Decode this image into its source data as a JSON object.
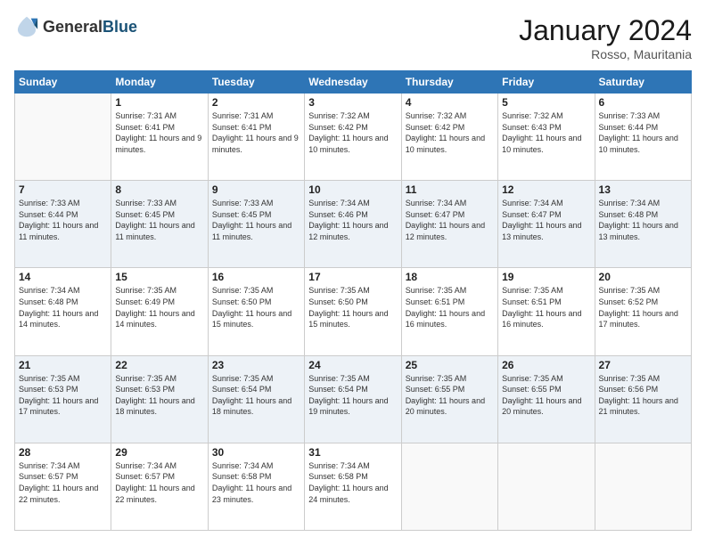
{
  "header": {
    "logo_general": "General",
    "logo_blue": "Blue",
    "month_title": "January 2024",
    "location": "Rosso, Mauritania"
  },
  "weekdays": [
    "Sunday",
    "Monday",
    "Tuesday",
    "Wednesday",
    "Thursday",
    "Friday",
    "Saturday"
  ],
  "weeks": [
    [
      {
        "day": "",
        "sunrise": "",
        "sunset": "",
        "daylight": ""
      },
      {
        "day": "1",
        "sunrise": "Sunrise: 7:31 AM",
        "sunset": "Sunset: 6:41 PM",
        "daylight": "Daylight: 11 hours and 9 minutes."
      },
      {
        "day": "2",
        "sunrise": "Sunrise: 7:31 AM",
        "sunset": "Sunset: 6:41 PM",
        "daylight": "Daylight: 11 hours and 9 minutes."
      },
      {
        "day": "3",
        "sunrise": "Sunrise: 7:32 AM",
        "sunset": "Sunset: 6:42 PM",
        "daylight": "Daylight: 11 hours and 10 minutes."
      },
      {
        "day": "4",
        "sunrise": "Sunrise: 7:32 AM",
        "sunset": "Sunset: 6:42 PM",
        "daylight": "Daylight: 11 hours and 10 minutes."
      },
      {
        "day": "5",
        "sunrise": "Sunrise: 7:32 AM",
        "sunset": "Sunset: 6:43 PM",
        "daylight": "Daylight: 11 hours and 10 minutes."
      },
      {
        "day": "6",
        "sunrise": "Sunrise: 7:33 AM",
        "sunset": "Sunset: 6:44 PM",
        "daylight": "Daylight: 11 hours and 10 minutes."
      }
    ],
    [
      {
        "day": "7",
        "sunrise": "Sunrise: 7:33 AM",
        "sunset": "Sunset: 6:44 PM",
        "daylight": "Daylight: 11 hours and 11 minutes."
      },
      {
        "day": "8",
        "sunrise": "Sunrise: 7:33 AM",
        "sunset": "Sunset: 6:45 PM",
        "daylight": "Daylight: 11 hours and 11 minutes."
      },
      {
        "day": "9",
        "sunrise": "Sunrise: 7:33 AM",
        "sunset": "Sunset: 6:45 PM",
        "daylight": "Daylight: 11 hours and 11 minutes."
      },
      {
        "day": "10",
        "sunrise": "Sunrise: 7:34 AM",
        "sunset": "Sunset: 6:46 PM",
        "daylight": "Daylight: 11 hours and 12 minutes."
      },
      {
        "day": "11",
        "sunrise": "Sunrise: 7:34 AM",
        "sunset": "Sunset: 6:47 PM",
        "daylight": "Daylight: 11 hours and 12 minutes."
      },
      {
        "day": "12",
        "sunrise": "Sunrise: 7:34 AM",
        "sunset": "Sunset: 6:47 PM",
        "daylight": "Daylight: 11 hours and 13 minutes."
      },
      {
        "day": "13",
        "sunrise": "Sunrise: 7:34 AM",
        "sunset": "Sunset: 6:48 PM",
        "daylight": "Daylight: 11 hours and 13 minutes."
      }
    ],
    [
      {
        "day": "14",
        "sunrise": "Sunrise: 7:34 AM",
        "sunset": "Sunset: 6:48 PM",
        "daylight": "Daylight: 11 hours and 14 minutes."
      },
      {
        "day": "15",
        "sunrise": "Sunrise: 7:35 AM",
        "sunset": "Sunset: 6:49 PM",
        "daylight": "Daylight: 11 hours and 14 minutes."
      },
      {
        "day": "16",
        "sunrise": "Sunrise: 7:35 AM",
        "sunset": "Sunset: 6:50 PM",
        "daylight": "Daylight: 11 hours and 15 minutes."
      },
      {
        "day": "17",
        "sunrise": "Sunrise: 7:35 AM",
        "sunset": "Sunset: 6:50 PM",
        "daylight": "Daylight: 11 hours and 15 minutes."
      },
      {
        "day": "18",
        "sunrise": "Sunrise: 7:35 AM",
        "sunset": "Sunset: 6:51 PM",
        "daylight": "Daylight: 11 hours and 16 minutes."
      },
      {
        "day": "19",
        "sunrise": "Sunrise: 7:35 AM",
        "sunset": "Sunset: 6:51 PM",
        "daylight": "Daylight: 11 hours and 16 minutes."
      },
      {
        "day": "20",
        "sunrise": "Sunrise: 7:35 AM",
        "sunset": "Sunset: 6:52 PM",
        "daylight": "Daylight: 11 hours and 17 minutes."
      }
    ],
    [
      {
        "day": "21",
        "sunrise": "Sunrise: 7:35 AM",
        "sunset": "Sunset: 6:53 PM",
        "daylight": "Daylight: 11 hours and 17 minutes."
      },
      {
        "day": "22",
        "sunrise": "Sunrise: 7:35 AM",
        "sunset": "Sunset: 6:53 PM",
        "daylight": "Daylight: 11 hours and 18 minutes."
      },
      {
        "day": "23",
        "sunrise": "Sunrise: 7:35 AM",
        "sunset": "Sunset: 6:54 PM",
        "daylight": "Daylight: 11 hours and 18 minutes."
      },
      {
        "day": "24",
        "sunrise": "Sunrise: 7:35 AM",
        "sunset": "Sunset: 6:54 PM",
        "daylight": "Daylight: 11 hours and 19 minutes."
      },
      {
        "day": "25",
        "sunrise": "Sunrise: 7:35 AM",
        "sunset": "Sunset: 6:55 PM",
        "daylight": "Daylight: 11 hours and 20 minutes."
      },
      {
        "day": "26",
        "sunrise": "Sunrise: 7:35 AM",
        "sunset": "Sunset: 6:55 PM",
        "daylight": "Daylight: 11 hours and 20 minutes."
      },
      {
        "day": "27",
        "sunrise": "Sunrise: 7:35 AM",
        "sunset": "Sunset: 6:56 PM",
        "daylight": "Daylight: 11 hours and 21 minutes."
      }
    ],
    [
      {
        "day": "28",
        "sunrise": "Sunrise: 7:34 AM",
        "sunset": "Sunset: 6:57 PM",
        "daylight": "Daylight: 11 hours and 22 minutes."
      },
      {
        "day": "29",
        "sunrise": "Sunrise: 7:34 AM",
        "sunset": "Sunset: 6:57 PM",
        "daylight": "Daylight: 11 hours and 22 minutes."
      },
      {
        "day": "30",
        "sunrise": "Sunrise: 7:34 AM",
        "sunset": "Sunset: 6:58 PM",
        "daylight": "Daylight: 11 hours and 23 minutes."
      },
      {
        "day": "31",
        "sunrise": "Sunrise: 7:34 AM",
        "sunset": "Sunset: 6:58 PM",
        "daylight": "Daylight: 11 hours and 24 minutes."
      },
      {
        "day": "",
        "sunrise": "",
        "sunset": "",
        "daylight": ""
      },
      {
        "day": "",
        "sunrise": "",
        "sunset": "",
        "daylight": ""
      },
      {
        "day": "",
        "sunrise": "",
        "sunset": "",
        "daylight": ""
      }
    ]
  ]
}
